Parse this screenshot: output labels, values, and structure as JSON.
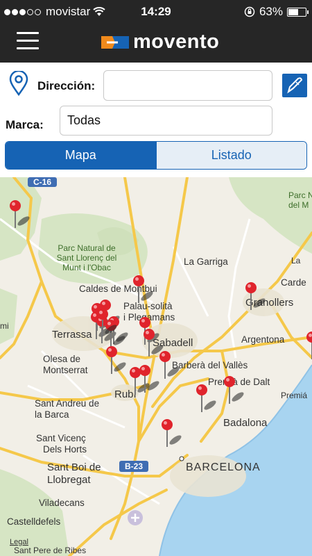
{
  "status_bar": {
    "carrier": "movistar",
    "time": "14:29",
    "battery": "63%",
    "battery_level": 0.63
  },
  "nav": {
    "brand": "movento",
    "brand_colors": {
      "orange": "#f08a1c",
      "blue": "#1663b4"
    }
  },
  "form": {
    "address_label": "Dirección:",
    "address_value": "",
    "brand_label": "Marca:",
    "brand_value": "Todas"
  },
  "segments": [
    {
      "label": "Mapa",
      "selected": true
    },
    {
      "label": "Listado",
      "selected": false
    }
  ],
  "map": {
    "road_shields": [
      "C-16",
      "B-23"
    ],
    "places": {
      "sant_llorenc": [
        "Parc Natural de",
        "Sant Llorenç del",
        "Munt i l'Obac"
      ],
      "parc_top_right": [
        "Parc N",
        "del M"
      ],
      "la_garriga": "La Garriga",
      "caldes": "Caldes de Montbui",
      "cardedeu": "Carde",
      "palau": [
        "Palau-solità",
        "i Plegamans"
      ],
      "granollers": "Granollers",
      "terrassa": "Terrassa",
      "sabadell": "Sabadell",
      "argentona": "Argentona",
      "mi": "mi",
      "olesa": [
        "Olesa de",
        "Montserrat"
      ],
      "barbera": "Barberà del Vallès",
      "premia_dalt": "Premià de Dalt",
      "rubi": "Rubí",
      "premia": "Premiá",
      "sant_andreu": [
        "Sant Andreu de",
        "la Barca"
      ],
      "badalona": "Badalona",
      "sant_vicenc": [
        "Sant Vicenç",
        "Dels Horts"
      ],
      "sant_boi": [
        "Sant Boi de",
        "Llobregat"
      ],
      "barcelona": "BARCELONA",
      "viladecans": "Viladecans",
      "castelldefels": "Castelldefels",
      "sant_pere": "Sant Pere de Ribes",
      "la_roca": "La"
    },
    "legal": "Legal",
    "markers_count": 20
  }
}
